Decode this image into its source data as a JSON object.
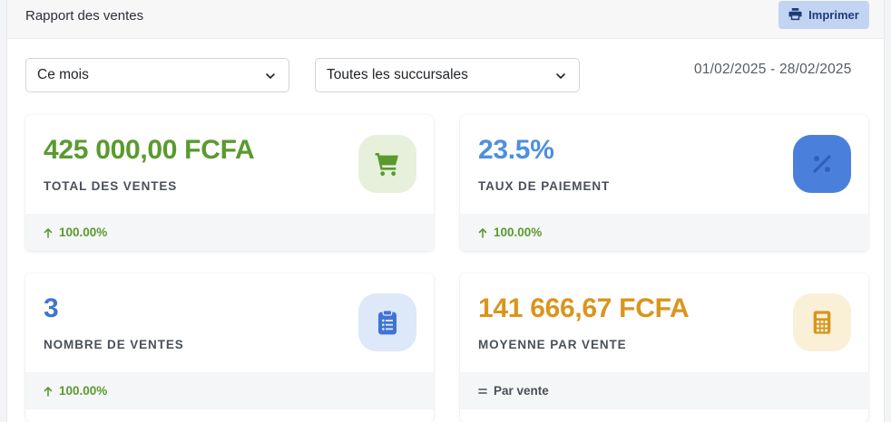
{
  "header": {
    "title": "Rapport des ventes",
    "print_label": "Imprimer"
  },
  "filters": {
    "period": "Ce mois",
    "branch": "Toutes les succursales",
    "date_range": "01/02/2025 - 28/02/2025"
  },
  "cards": [
    {
      "value": "425 000,00 FCFA",
      "label": "TOTAL DES VENTES",
      "footer": "100.00%",
      "icon": "shopping-cart-icon",
      "value_color": "#5a9a2f",
      "icon_bg": "#e6f0da",
      "icon_color": "#5a9a2f"
    },
    {
      "value": "23.5%",
      "label": "TAUX DE PAIEMENT",
      "footer": "100.00%",
      "icon": "percent-icon",
      "value_color": "#4d8fe0",
      "icon_bg": "#4a7fdc",
      "icon_color": "#2f5fc0"
    },
    {
      "value": "3",
      "label": "NOMBRE DE VENTES",
      "footer": "100.00%",
      "icon": "clipboard-list-icon",
      "value_color": "#3f74d4",
      "icon_bg": "#dde8f8",
      "icon_color": "#3f74d4"
    },
    {
      "value": "141 666,67 FCFA",
      "label": "MOYENNE PAR VENTE",
      "footer": "Par vente",
      "icon": "calculator-icon",
      "value_color": "#d9951c",
      "icon_bg": "#faf0d8",
      "icon_color": "#d9951c"
    }
  ],
  "colors": {
    "positive": "#5a9a2f",
    "neutral": "#4a5058",
    "accent": "#1f3a78"
  }
}
